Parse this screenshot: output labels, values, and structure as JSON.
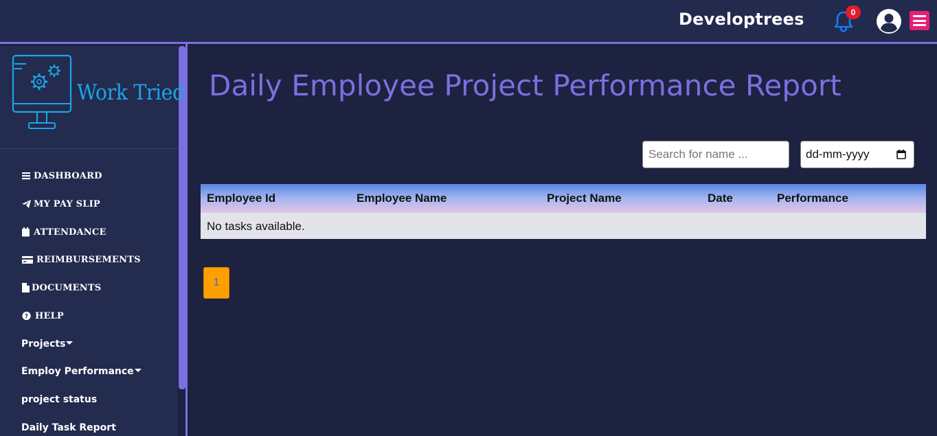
{
  "header": {
    "brand": "Developtrees",
    "notification_count": "0"
  },
  "sidebar": {
    "logo_text": "Work Tried",
    "items": [
      {
        "label": "DASHBOARD",
        "icon": "bars-icon"
      },
      {
        "label": "MY PAY SLIP",
        "icon": "paper-plane-icon"
      },
      {
        "label": "ATTENDANCE",
        "icon": "calendar-icon"
      },
      {
        "label": "REIMBURSEMENTS",
        "icon": "credit-card-icon"
      },
      {
        "label": "DOCUMENTS",
        "icon": "file-icon"
      },
      {
        "label": "HELP",
        "icon": "question-circle-icon"
      },
      {
        "label": "Projects"
      },
      {
        "label": "Employ Performance"
      },
      {
        "label": "project status"
      },
      {
        "label": "Daily Task Report"
      }
    ]
  },
  "main": {
    "title": "Daily Employee Project Performance Report",
    "search_placeholder": "Search for name ...",
    "date_value": "dd-mm-yyyy",
    "table": {
      "columns": [
        "Employee Id",
        "Employee Name",
        "Project Name",
        "Date",
        "Performance"
      ],
      "empty_message": "No tasks available."
    },
    "pagination": {
      "current_page": "1"
    }
  },
  "colors": {
    "background": "#1c2240",
    "topbar": "#222a4e",
    "accent": "#7c6fe0",
    "menu_button": "#e91e74",
    "badge": "#e11d2a",
    "bell": "#1a7bf0",
    "logo": "#1aa6e6",
    "page_button": "#ff9f00"
  }
}
